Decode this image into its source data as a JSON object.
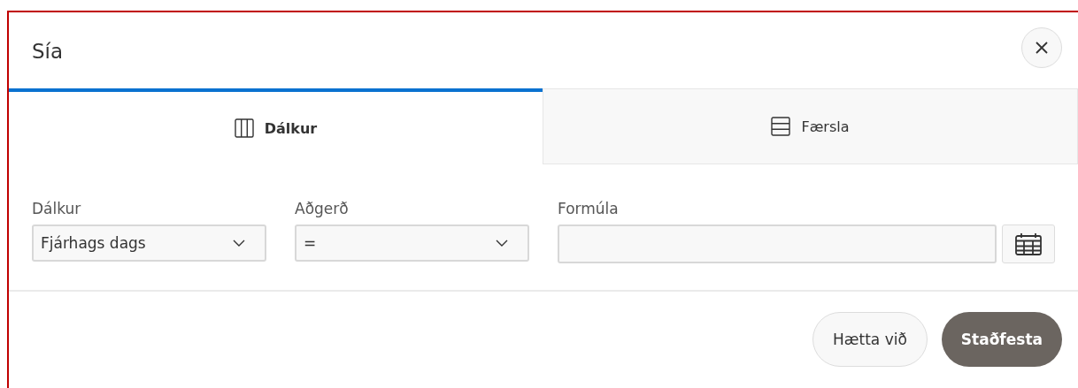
{
  "dialog": {
    "title": "Sía"
  },
  "tabs": [
    {
      "label": "Dálkur",
      "kind": "columns",
      "selected": true
    },
    {
      "label": "Færsla",
      "kind": "rows",
      "selected": false
    }
  ],
  "fields": [
    {
      "label": "Dálkur",
      "kind": "select",
      "value": "Fjárhags dags"
    },
    {
      "label": "Aðgerð",
      "kind": "select",
      "value": "="
    },
    {
      "label": "Formúla",
      "kind": "date"
    }
  ],
  "buttons": [
    {
      "label": "Hætta við",
      "kind": "secondary"
    },
    {
      "label": "Staðfesta",
      "kind": "primary"
    }
  ]
}
